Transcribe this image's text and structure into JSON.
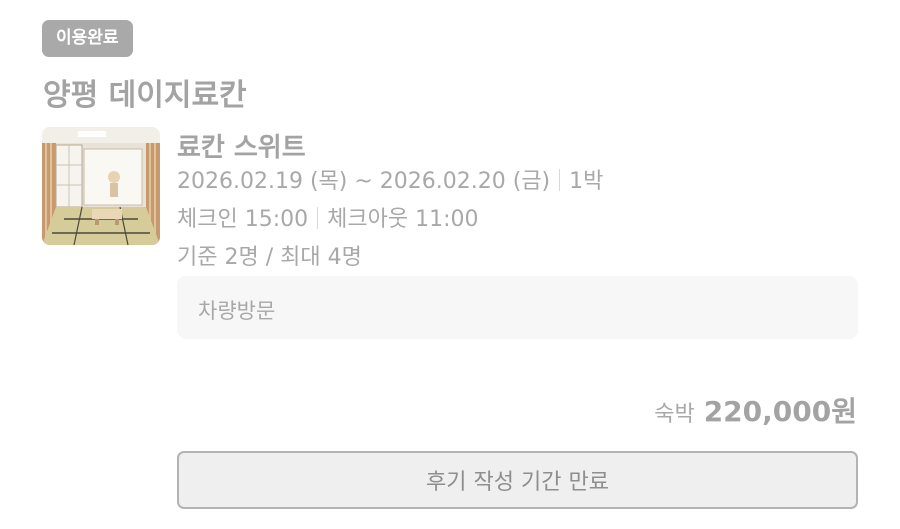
{
  "status_badge": "이용완료",
  "property_name": "양평 데이지료칸",
  "thumbnail_icon": "room-photo",
  "room": {
    "name": "료칸 스위트",
    "date_range": "2026.02.19 (목) ~ 2026.02.20 (금)",
    "nights": "1박",
    "check_in": "체크인 15:00",
    "check_out": "체크아웃 11:00",
    "capacity": "기준 2명 / 최대 4명"
  },
  "visit_note": "차량방문",
  "price": {
    "label": "숙박",
    "amount": "220,000원"
  },
  "review_button": "후기 작성 기간 만료"
}
